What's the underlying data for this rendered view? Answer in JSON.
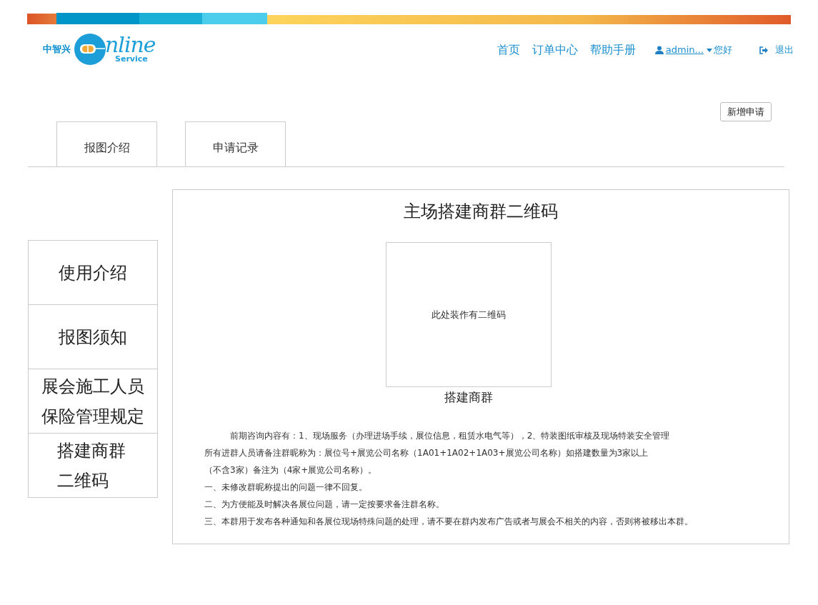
{
  "logo": {
    "brand": "中智兴",
    "word": "nline",
    "tagline": "Service"
  },
  "nav": {
    "links": [
      "首页",
      "订单中心",
      "帮助手册"
    ],
    "user": "admin...",
    "greeting": "您好",
    "logout": "退出"
  },
  "new_button": "新增申请",
  "tabs": [
    "报图介绍",
    "申请记录"
  ],
  "sidebar": {
    "items": [
      {
        "label": "使用介绍"
      },
      {
        "label": "报图须知"
      },
      {
        "label": "展会施工人员保险管理规定"
      },
      {
        "label": "搭建商群二维码"
      }
    ]
  },
  "panel": {
    "title": "主场搭建商群二维码",
    "qr_placeholder": "此处装作有二维码",
    "qr_caption": "搭建商群",
    "lines": [
      {
        "kind": "indented",
        "text": "前期咨询内容有：1、现场服务（办理进场手续，展位信息，租赁水电气等），2、特装图纸审核及现场特装安全管理"
      },
      {
        "kind": "plain",
        "text": "所有进群人员请备注群昵称为：展位号+展览公司名称（1A01+1A02+1A03+展览公司名称）如搭建数量为3家以上"
      },
      {
        "kind": "plain",
        "text": "（不含3家）备注为（4家+展览公司名称）。"
      },
      {
        "kind": "plain",
        "text": "一、未修改群昵称提出的问题一律不回复。"
      },
      {
        "kind": "plain",
        "text": "二、为方便能及时解决各展位问题，请一定按要求备注群名称。"
      },
      {
        "kind": "plain",
        "text": "三、本群用于发布各种通知和各展位现场特殊问题的处理，请不要在群内发布广告或者与展会不相关的内容，否则将被移出本群。"
      }
    ]
  }
}
